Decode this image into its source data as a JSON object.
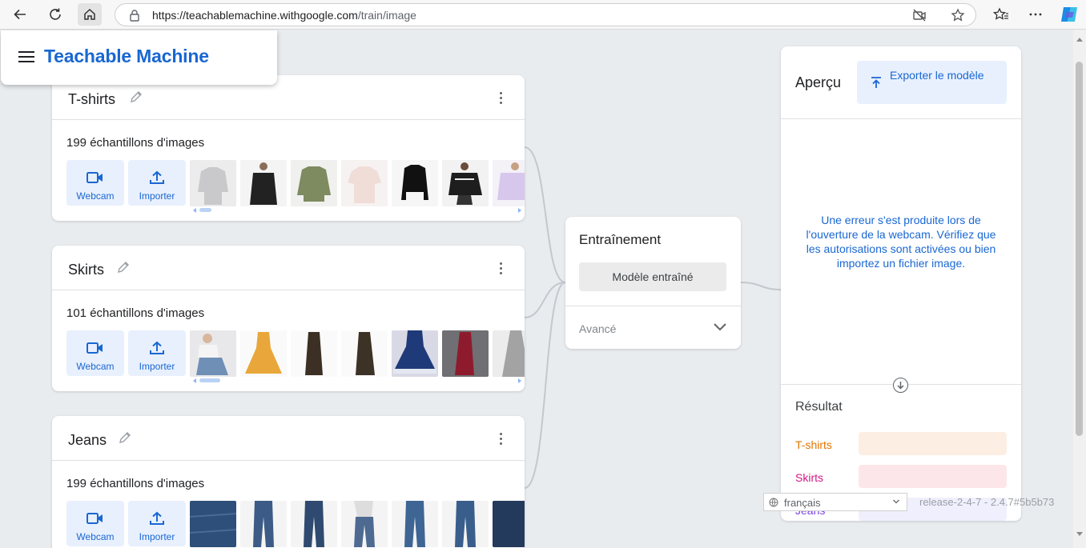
{
  "browser": {
    "url_host": "https://teachablemachine.withgoogle.com",
    "url_path": "/train/image"
  },
  "app": {
    "brand": "Teachable Machine"
  },
  "classes": [
    {
      "name": "T-shirts",
      "count_label": "199 échantillons d'images",
      "webcam_label": "Webcam",
      "upload_label": "Importer",
      "thumbs": [
        "#c9c9cc",
        "#222222",
        "#7e8a5f",
        "#f0ddd8",
        "#111111",
        "#1e1e1e",
        "#d7c7ec"
      ]
    },
    {
      "name": "Skirts",
      "count_label": "101 échantillons d'images",
      "webcam_label": "Webcam",
      "upload_label": "Importer",
      "thumbs": [
        "#b6c4d6",
        "#e9a63a",
        "#3b3023",
        "#3d3226",
        "#1f3a78",
        "#8e1b2d",
        "#a3a3a3"
      ]
    },
    {
      "name": "Jeans",
      "count_label": "199 échantillons d'images",
      "webcam_label": "Webcam",
      "upload_label": "Importer",
      "thumbs": [
        "#2e4f7a",
        "#3c5b86",
        "#2f4a70",
        "#4e6a91",
        "#3e6594",
        "#3a5e8c",
        "#243a5c"
      ]
    }
  ],
  "training": {
    "title": "Entraînement",
    "button_label": "Modèle entraîné",
    "advanced_label": "Avancé"
  },
  "preview": {
    "title": "Aperçu",
    "export_label": "Exporter le modèle",
    "error_message": "Une erreur s'est produite lors de l'ouverture de la webcam. Vérifiez que les autorisations sont activées ou bien importez un fichier image.",
    "result_title": "Résultat",
    "results": [
      {
        "label": "T-shirts",
        "text_color": "#e37400",
        "bar_color": "#fdeee3"
      },
      {
        "label": "Skirts",
        "text_color": "#d01884",
        "bar_color": "#fde6ea"
      },
      {
        "label": "Jeans",
        "text_color": "#7b3fe4",
        "bar_color": "#efeffd"
      }
    ]
  },
  "footer": {
    "language": "français",
    "release": "release-2-4-7 - 2.4.7#5b5b73"
  }
}
